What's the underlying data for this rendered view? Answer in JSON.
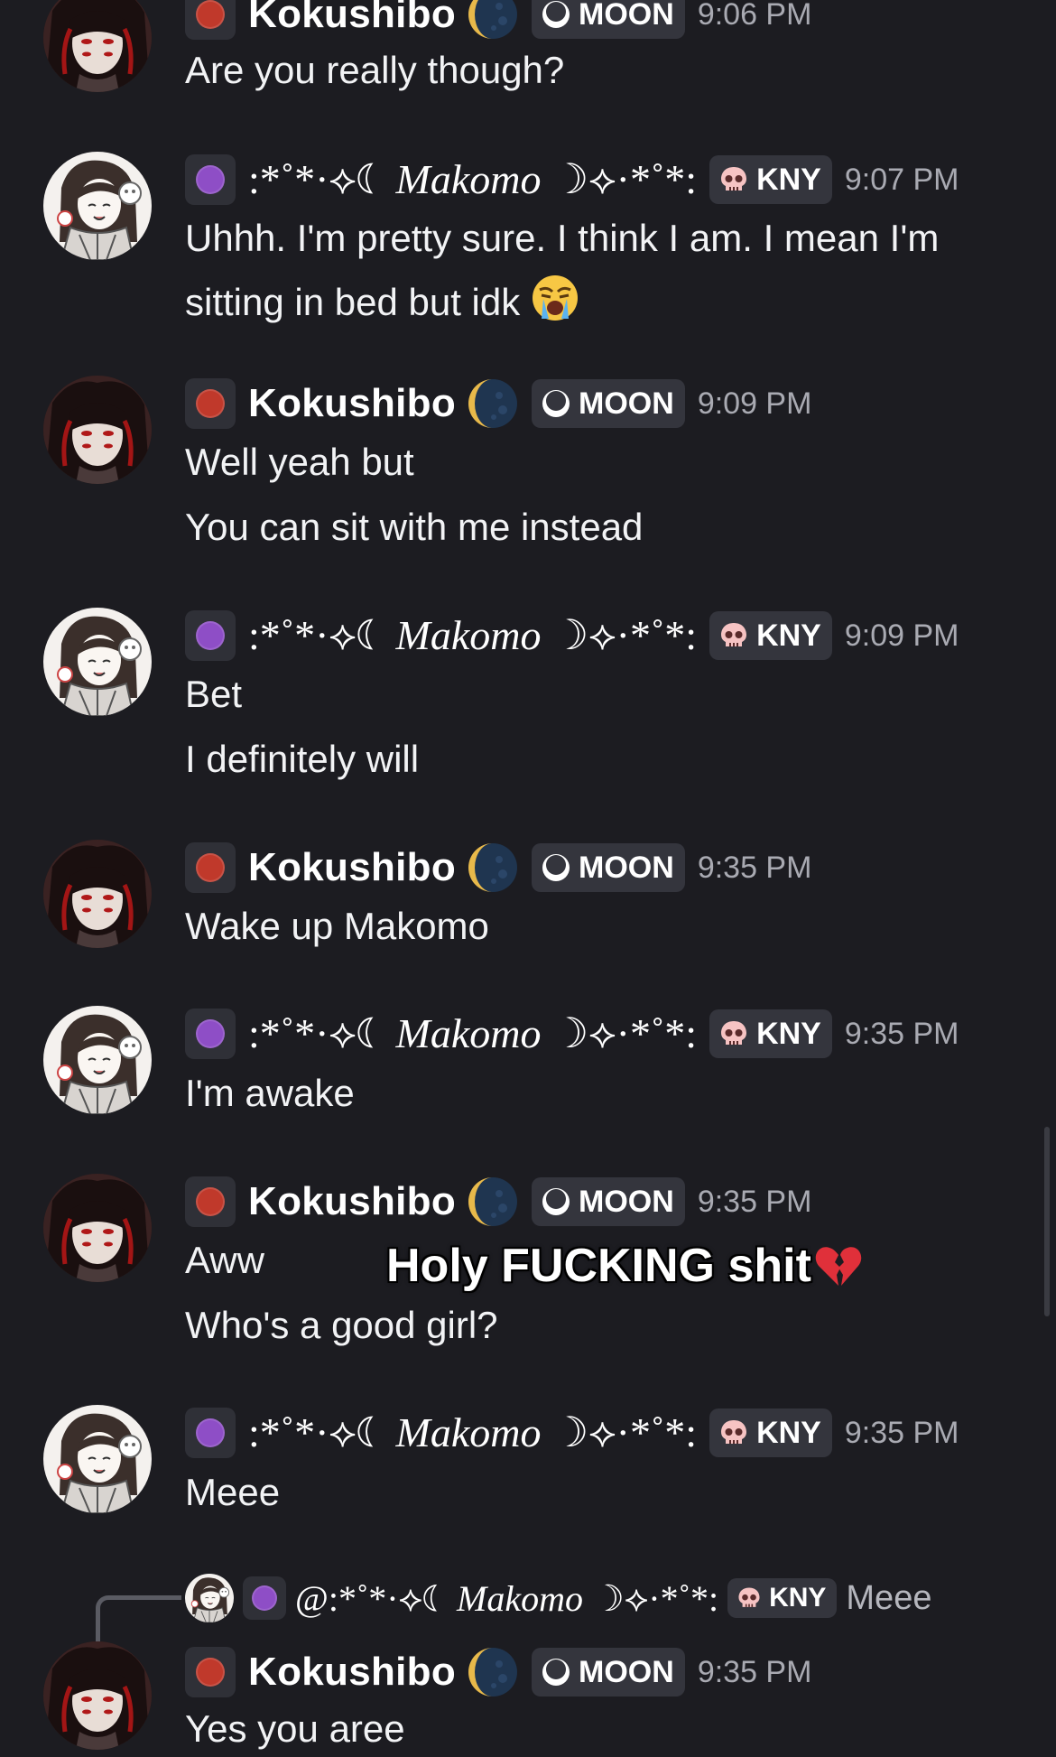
{
  "colors": {
    "background": "#1c1c21",
    "kokushibo_role": "#c0392b",
    "makomo_role": "#8e4ec6",
    "timestamp": "#a9aab2",
    "tag_bg": "#34353d"
  },
  "users": {
    "kokushibo": {
      "name": "Kokushibo",
      "tag": "MOON",
      "tag_icon": "crescent-moon-icon",
      "emoji": "new-moon-emoji"
    },
    "makomo": {
      "name_left": ":*˚*·⟡☾ ",
      "name_main": "Makomo",
      "name_right": " ☽⟡·*˚*:",
      "tag": "KNY",
      "tag_icon": "skull-icon"
    }
  },
  "messages": [
    {
      "author": "Kokushibo",
      "time": "9:06 PM",
      "lines": [
        "Are you really though?"
      ]
    },
    {
      "author": "Makomo",
      "time": "9:07 PM",
      "lines": [
        "Uhhh. I'm pretty sure. I think I am. I mean I'm",
        "sitting in bed but idk"
      ],
      "emoji": "loudly-crying-face"
    },
    {
      "author": "Kokushibo",
      "time": "9:09 PM",
      "lines": [
        "Well yeah but",
        "You can sit with me instead"
      ]
    },
    {
      "author": "Makomo",
      "time": "9:09 PM",
      "lines": [
        "Bet",
        "I definitely will"
      ]
    },
    {
      "author": "Kokushibo",
      "time": "9:35 PM",
      "lines": [
        "Wake up Makomo"
      ]
    },
    {
      "author": "Makomo",
      "time": "9:35 PM",
      "lines": [
        "I'm awake"
      ]
    },
    {
      "author": "Kokushibo",
      "time": "9:35 PM",
      "lines": [
        "Aww",
        "Who's a good girl?"
      ]
    },
    {
      "author": "Makomo",
      "time": "9:35 PM",
      "lines": [
        "Meee"
      ]
    },
    {
      "author": "Kokushibo",
      "time": "9:35 PM",
      "lines": [
        "Yes you aree"
      ],
      "reply_to": {
        "mention": "@:*˚*·⟡☾ ",
        "name": "Makomo",
        "suffix": " ☽⟡·*˚*:",
        "tag": "KNY",
        "text": "Meee"
      }
    }
  ],
  "overlay": {
    "text": "Holy FUCKING shit",
    "emoji": "broken-heart"
  }
}
